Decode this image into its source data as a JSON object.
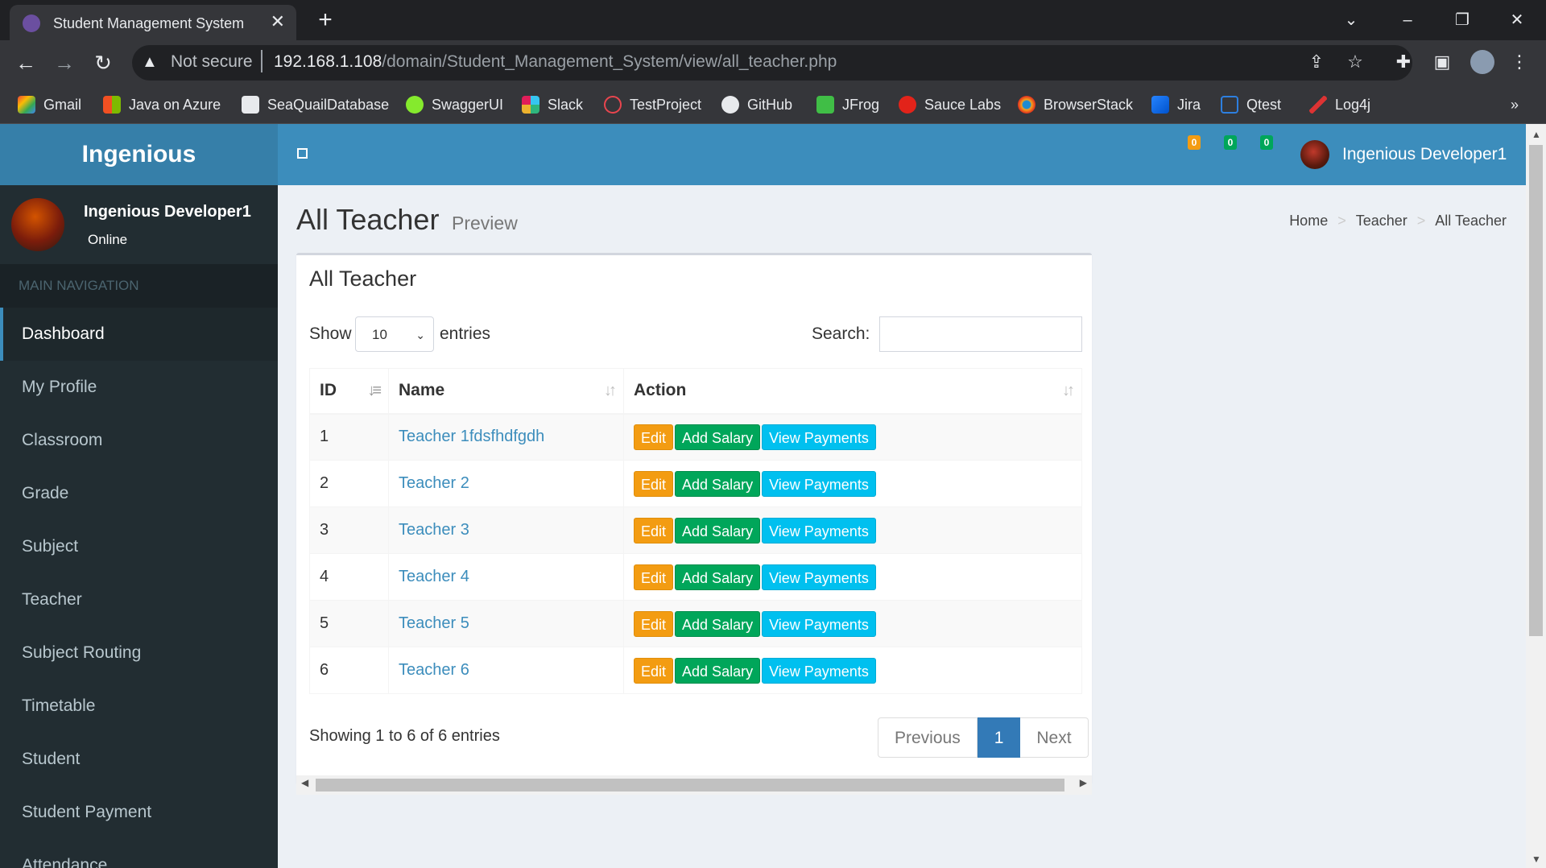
{
  "browser": {
    "tab_title": "Student Management System",
    "not_secure": "Not secure",
    "url_host": "192.168.1.108",
    "url_path": "/domain/Student_Management_System/view/all_teacher.php",
    "bookmarks": [
      "Gmail",
      "Java on Azure",
      "SeaQuailDatabase",
      "SwaggerUI",
      "Slack",
      "TestProject",
      "GitHub",
      "JFrog",
      "Sauce Labs",
      "BrowserStack",
      "Jira",
      "Qtest",
      "Log4j"
    ],
    "more": "»"
  },
  "app": {
    "logo": "Ingenious",
    "badges": [
      "0",
      "0",
      "0"
    ],
    "nav_user": "Ingenious Developer1"
  },
  "sidebar": {
    "user_name": "Ingenious Developer1",
    "user_status": "Online",
    "header": "MAIN NAVIGATION",
    "items": [
      "Dashboard",
      "My Profile",
      "Classroom",
      "Grade",
      "Subject",
      "Teacher",
      "Subject Routing",
      "Timetable",
      "Student",
      "Student Payment",
      "Attendance"
    ]
  },
  "content": {
    "title": "All Teacher",
    "subtitle": "Preview",
    "breadcrumb": [
      "Home",
      "Teacher",
      "All Teacher"
    ],
    "box_title": "All Teacher",
    "show_label": "Show",
    "entries_value": "10",
    "entries_label": "entries",
    "search_label": "Search:",
    "columns": [
      "ID",
      "Name",
      "Action"
    ],
    "rows": [
      {
        "id": "1",
        "name": "Teacher 1fdsfhdfgdh"
      },
      {
        "id": "2",
        "name": "Teacher 2"
      },
      {
        "id": "3",
        "name": "Teacher 3"
      },
      {
        "id": "4",
        "name": "Teacher 4"
      },
      {
        "id": "5",
        "name": "Teacher 5"
      },
      {
        "id": "6",
        "name": "Teacher 6"
      }
    ],
    "actions": {
      "edit": "Edit",
      "salary": "Add Salary",
      "payments": "View Payments"
    },
    "info": "Showing 1 to 6 of 6 entries",
    "pager": {
      "previous": "Previous",
      "page": "1",
      "next": "Next"
    }
  },
  "colors": {
    "header_blue": "#3c8dbc",
    "logo_blue": "#367fa9",
    "sidebar_dark": "#222d32",
    "edit_orange": "#f39c12",
    "salary_green": "#00a65a",
    "payments_cyan": "#00c0ef"
  }
}
